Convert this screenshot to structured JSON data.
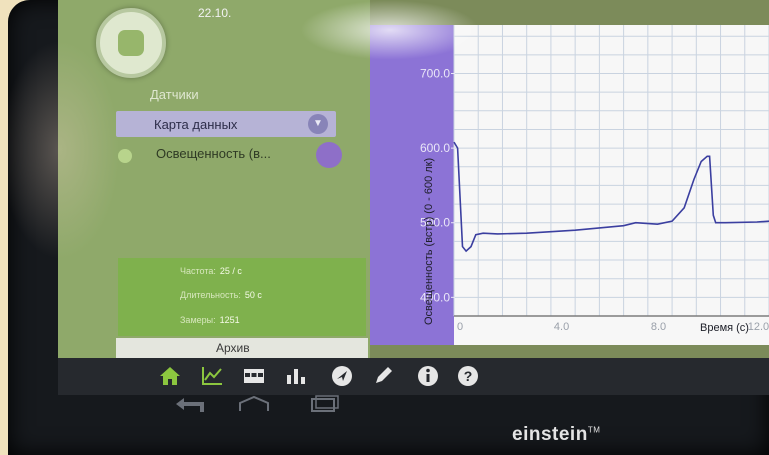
{
  "status": {
    "date": "22.10."
  },
  "sidebar": {
    "heading": "Датчики",
    "data_map_label": "Карта данных",
    "sensor_label": "Освещенность (в...",
    "sensor_color": "#8e6fc8",
    "stats": [
      {
        "label": "Частота:",
        "value": "25 / с"
      },
      {
        "label": "Длительность:",
        "value": "50 с"
      },
      {
        "label": "Замеры:",
        "value": "1251"
      }
    ],
    "archive_label": "Архив"
  },
  "toolbar": {
    "icons": [
      "home-icon",
      "graph-icon",
      "table-icon",
      "bar-chart-icon",
      "navigation-icon",
      "pen-icon",
      "info-icon",
      "help-icon"
    ]
  },
  "brand": {
    "name": "einstein",
    "tm": "TM"
  },
  "colors": {
    "accent": "#7fb14d",
    "axis_band": "#8c73d6",
    "line": "#3b3fa0"
  },
  "chart_data": {
    "type": "line",
    "ylabel": "Освещенность (встр) (0 - 600 лк)",
    "xlabel": "Время (с)",
    "yticks": [
      "700.0",
      "600.0",
      "500.0",
      "400.0"
    ],
    "xticks": [
      "0",
      "4.0",
      "8.0",
      "12.0"
    ],
    "xlim": [
      0,
      13
    ],
    "ylim": [
      375,
      765
    ],
    "grid": true,
    "series": [
      {
        "x": [
          0,
          0.15,
          0.35,
          0.5,
          0.7,
          0.9,
          1.2,
          1.8,
          3,
          5,
          7,
          7.5,
          8.4,
          9.0,
          9.5,
          9.9,
          10.2,
          10.45,
          10.55,
          10.7,
          10.8,
          11.2,
          12.5,
          13
        ],
        "values": [
          608,
          600,
          468,
          462,
          468,
          484,
          486,
          485,
          486,
          490,
          496,
          500,
          498,
          502,
          520,
          558,
          582,
          589,
          589,
          510,
          500,
          500,
          501,
          502
        ]
      }
    ]
  }
}
